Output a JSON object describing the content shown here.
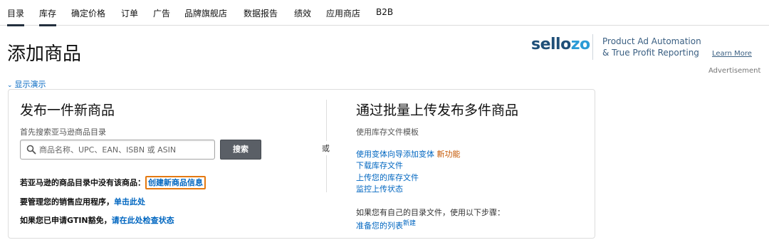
{
  "nav": {
    "items": [
      {
        "label": "目录",
        "active": true
      },
      {
        "label": "库存",
        "active": true
      },
      {
        "label": "确定价格",
        "active": false
      },
      {
        "label": "订单",
        "active": false
      },
      {
        "label": "广告",
        "active": false
      },
      {
        "label": "品牌旗舰店",
        "active": false
      },
      {
        "label": "数据报告",
        "active": false
      },
      {
        "label": "绩效",
        "active": false
      },
      {
        "label": "应用商店",
        "active": false
      },
      {
        "label": "B2B",
        "active": false
      }
    ]
  },
  "page": {
    "title": "添加商品",
    "show_demo": "显示演示"
  },
  "ad": {
    "logo_part1": "sello",
    "logo_part2": "zo",
    "tagline_line1": "Product Ad Automation",
    "tagline_line2": "& True Profit Reporting",
    "learn_more": "Learn More",
    "advertisement": "Advertisement"
  },
  "left": {
    "title": "发布一件新商品",
    "subtitle": "首先搜索亚马逊商品目录",
    "search_placeholder": "商品名称、UPC、EAN、ISBN 或 ASIN",
    "search_button": "搜索",
    "line1_text": "若亚马逊的商品目录中没有该商品：",
    "line1_link": "创建新商品信息",
    "line2_text": "要管理您的销售应用程序，",
    "line2_link": "单击此处",
    "line3_text": "如果您已申请GTIN豁免，",
    "line3_link": "请在此处检查状态"
  },
  "or_label": "或",
  "right": {
    "title": "通过批量上传发布多件商品",
    "subtitle": "使用库存文件模板",
    "link_variation": "使用变体向导添加变体",
    "new_feature": "新功能",
    "link_download": "下载库存文件",
    "link_upload": "上传您的库存文件",
    "link_monitor": "监控上传状态",
    "own_catalog_text": "如果您有自己的目录文件，使用以下步骤：",
    "link_prepare": "准备您的列表",
    "new_sup": "新建"
  }
}
